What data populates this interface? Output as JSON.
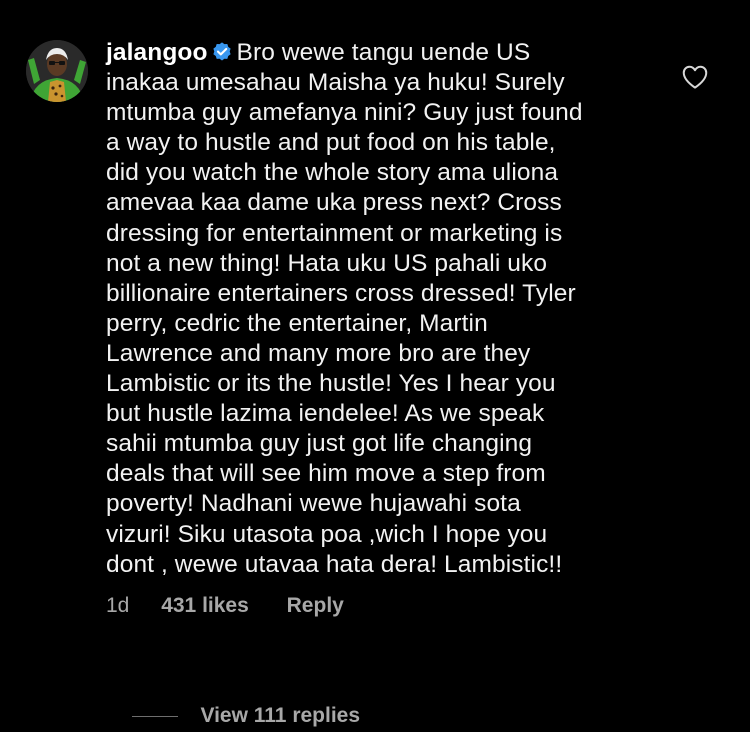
{
  "comment": {
    "username": "jalangoo",
    "verified": true,
    "text_lines": [
      "Bro wewe tangu uende US",
      "inakaa umesahau Maisha ya huku! Surely",
      "mtumba guy amefanya nini? Guy just found",
      "a way to hustle and put food on his table,",
      "did you watch the whole story ama uliona",
      "amevaa kaa dame uka press next? Cross",
      "dressing for entertainment or marketing is",
      "not a new thing! Hata uku US pahali uko",
      "billionaire entertainers cross dressed! Tyler",
      "perry, cedric the entertainer, Martin",
      "Lawrence and many more bro are they",
      "Lambistic or its the hustle! Yes I hear you",
      "but hustle lazima iendelee! As we speak",
      "sahii mtumba guy just got life changing",
      "deals that will see him move a step from",
      "poverty! Nadhani wewe hujawahi sota",
      "vizuri! Siku utasota poa ,wich I hope you",
      "dont , wewe utavaa hata dera! Lambistic!!"
    ],
    "time_ago": "1d",
    "likes_label": "431 likes",
    "reply_label": "Reply",
    "view_replies_label": "View 111 replies"
  },
  "icons": {
    "verified": "verified-badge-icon",
    "like": "heart-outline-icon"
  },
  "colors": {
    "background": "#000000",
    "text": "#f2f2f2",
    "secondary": "#a8a8a8",
    "verified_blue": "#3897f0"
  }
}
